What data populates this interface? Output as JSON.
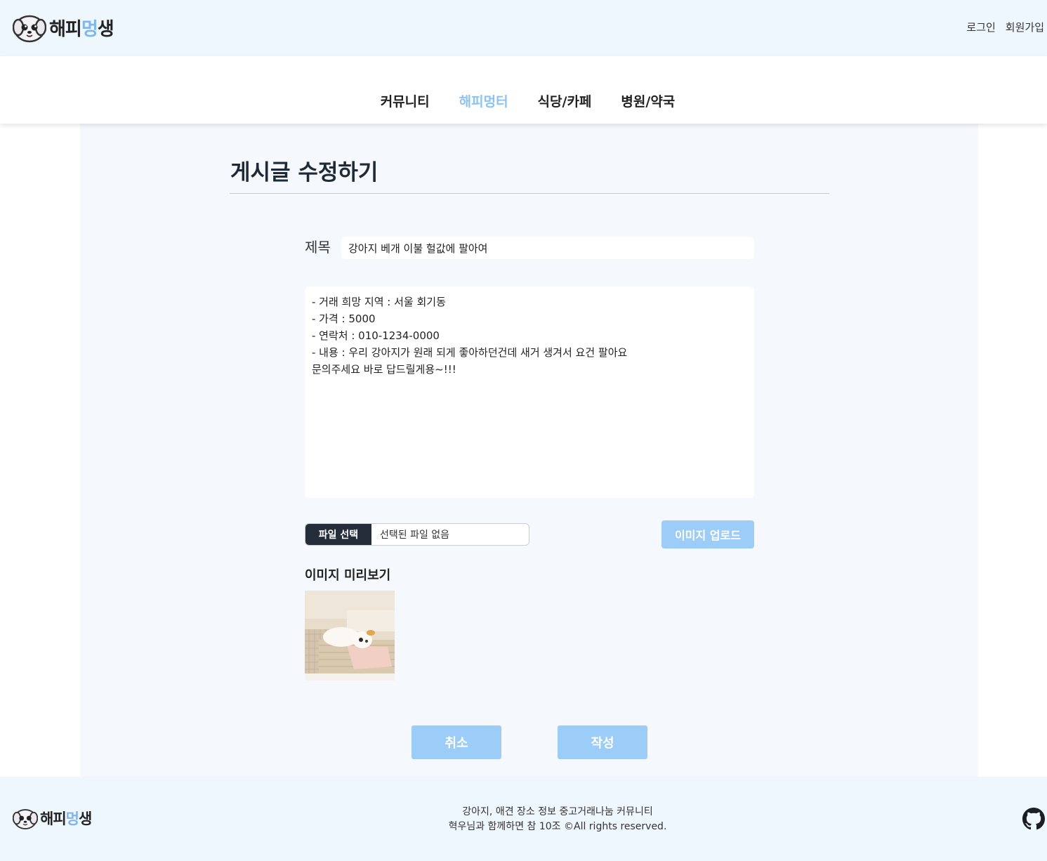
{
  "header": {
    "logo": {
      "prefix": "해피",
      "accent": "멍",
      "suffix": "생"
    },
    "auth": {
      "login": "로그인",
      "signup": "회원가입"
    }
  },
  "nav": {
    "items": [
      {
        "label": "커뮤니티"
      },
      {
        "label": "해피멍터",
        "active": true
      },
      {
        "label": "식당/카페"
      },
      {
        "label": "병원/약국"
      }
    ]
  },
  "editor": {
    "page_title": "게시글 수정하기",
    "title_label": "제목",
    "title_value": "강아지 베개 이불 헐값에 팔아여",
    "body_value": "- 거래 희망 지역 : 서울 회기동\n- 가격 : 5000\n- 연락처 : 010-1234-0000\n- 내용 : 우리 강아지가 원래 되게 좋아하던건데 새거 생겨서 요건 팔아요\n문의주세요 바로 답드릴게용~!!!",
    "file_button": "파일 선택",
    "file_status": "선택된 파일 없음",
    "upload_button": "이미지 업로드",
    "preview_label": "이미지 미리보기",
    "cancel_button": "취소",
    "submit_button": "작성"
  },
  "footer": {
    "line1": "강아지, 애견 장소 정보 중고거래나눔 커뮤니티",
    "line2": "혁우님과 함께하면 참 10조 ©All rights reserved."
  },
  "colors": {
    "accent": "#8cc3f7",
    "button": "#9ccdf8",
    "header_bg": "#eef6fe",
    "main_bg": "#f5f9fd",
    "dark": "#252d3b"
  },
  "icons": [
    "dog-mascot-icon",
    "github-icon"
  ]
}
